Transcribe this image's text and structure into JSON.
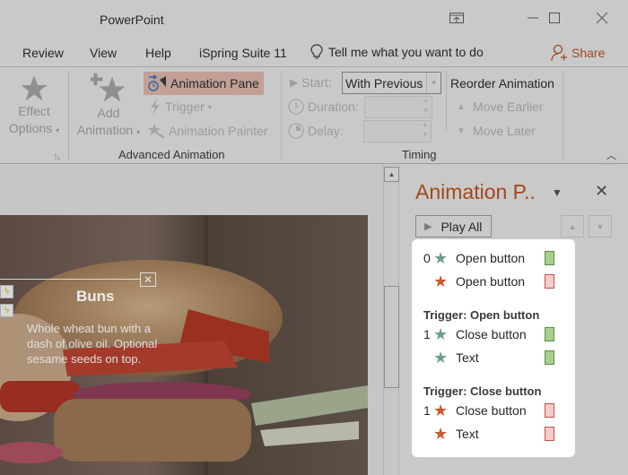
{
  "window": {
    "title": "PowerPoint",
    "controls": [
      "ribbon-display-options",
      "minimize",
      "maximize",
      "close"
    ]
  },
  "tabs": [
    {
      "label": "Review"
    },
    {
      "label": "View"
    },
    {
      "label": "Help"
    },
    {
      "label": "iSpring Suite 11"
    }
  ],
  "tell_me": {
    "placeholder": "Tell me what you want to do",
    "icon": "lightbulb-icon"
  },
  "share": {
    "label": "Share",
    "icon": "add-person-icon"
  },
  "ribbon": {
    "effect_options": {
      "line1": "Effect",
      "line2": "Options"
    },
    "add_animation": {
      "line1": "Add",
      "line2": "Animation"
    },
    "animation_pane": "Animation Pane",
    "trigger": "Trigger",
    "animation_painter": "Animation Painter",
    "advanced_group_label": "Advanced Animation",
    "start_label": "Start:",
    "start_value": "With Previous",
    "duration_label": "Duration:",
    "duration_value": "",
    "delay_label": "Delay:",
    "delay_value": "",
    "timing_group_label": "Timing",
    "reorder_title": "Reorder Animation",
    "move_earlier": "Move Earlier",
    "move_later": "Move Later"
  },
  "slide": {
    "callout_title": "Buns",
    "callout_body": "Whole wheat bun with a dash of olive oil. Optional sesame seeds on top."
  },
  "pane": {
    "title": "Animation P..",
    "play_all": "Play All",
    "groups": [
      {
        "trigger": "",
        "items": [
          {
            "num": "0",
            "type": "entrance",
            "name": "Open button",
            "bar": "entrance"
          },
          {
            "num": "",
            "type": "exit",
            "name": "Open button",
            "bar": "exit"
          }
        ]
      },
      {
        "trigger": "Trigger: Open button",
        "items": [
          {
            "num": "1",
            "type": "entrance",
            "name": "Close button",
            "bar": "entrance"
          },
          {
            "num": "",
            "type": "entrance",
            "name": "Text",
            "bar": "entrance"
          }
        ]
      },
      {
        "trigger": "Trigger: Close button",
        "items": [
          {
            "num": "1",
            "type": "exit",
            "name": "Close button",
            "bar": "exit"
          },
          {
            "num": "",
            "type": "exit",
            "name": "Text",
            "bar": "exit"
          }
        ]
      }
    ]
  },
  "colors": {
    "accent": "#a2481f",
    "entrance_star": "#6b9e8a",
    "exit_star": "#c8582f",
    "entrance_bar_fill": "#a8d08d",
    "entrance_bar_border": "#5e8b45",
    "exit_bar_fill": "#f4cccc",
    "exit_bar_border": "#c0504d",
    "highlight": "#c2a095"
  }
}
